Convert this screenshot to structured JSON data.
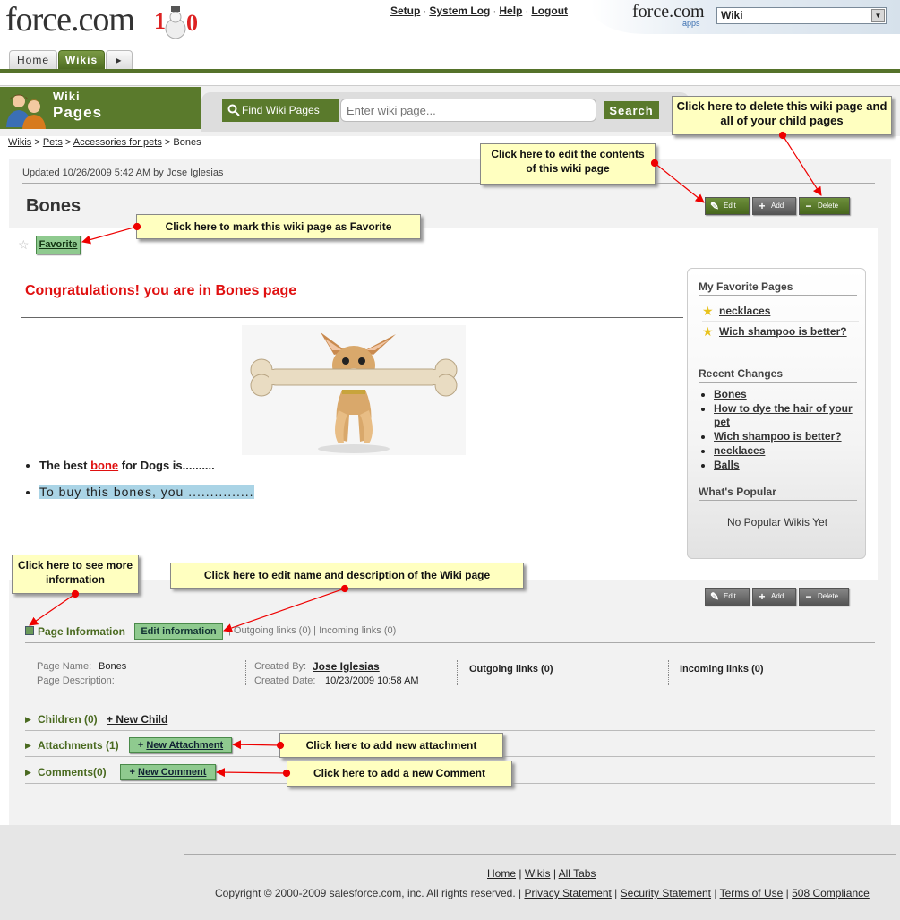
{
  "header": {
    "logo_text": "force.com",
    "top_links": [
      "Setup",
      "System Log",
      "Help",
      "Logout"
    ],
    "apps_logo": "force.com",
    "apps_sub": "apps",
    "app_selector_value": "Wiki"
  },
  "tabs": [
    "Home",
    "Wikis"
  ],
  "band": {
    "line1": "Wiki",
    "line2": "Pages",
    "find_label": "Find Wiki Pages",
    "search_placeholder": "Enter wiki page...",
    "search_button": "Search"
  },
  "breadcrumb": {
    "items": [
      "Wikis",
      "Pets",
      "Accessories for pets"
    ],
    "current": "Bones"
  },
  "page": {
    "updated": "Updated 10/26/2009 5:42 AM by Jose Iglesias",
    "title": "Bones",
    "buttons": {
      "edit": "Edit",
      "add": "Add",
      "delete": "Delete"
    },
    "favorite_button": "Favorite",
    "heading": "Congratulations! you are in Bones page",
    "bullet1_pre": "The best ",
    "bullet1_link": "bone",
    "bullet1_post": " for Dogs is..........",
    "bullet2": "To buy this bones, you ..............."
  },
  "sidebar": {
    "favorites_title": "My Favorite Pages",
    "favorites": [
      "necklaces",
      "Wich shampoo is better?"
    ],
    "recent_title": "Recent Changes",
    "recent": [
      "Bones",
      "How to dye the hair of your pet",
      "Wich shampoo is better?",
      "necklaces",
      "Balls"
    ],
    "popular_title": "What's Popular",
    "popular_empty": "No Popular Wikis Yet"
  },
  "page_info": {
    "label": "Page Information",
    "edit_button": "Edit information",
    "link_counts": "| Outgoing links (0) | Incoming links (0)",
    "page_name_label": "Page Name:",
    "page_name": "Bones",
    "page_desc_label": "Page Description:",
    "created_by_label": "Created By:",
    "created_by": "Jose Iglesias",
    "created_date_label": "Created Date:",
    "created_date": "10/23/2009 10:58 AM",
    "outgoing": "Outgoing links (0)",
    "incoming": "Incoming links (0)"
  },
  "sections": {
    "children": "Children (0)",
    "new_child": "+ New Child",
    "attachments": "Attachments (1)",
    "new_attachment": "New Attachment",
    "comments": "Comments(0)",
    "new_comment": "New Comment"
  },
  "footer": {
    "links": [
      "Home",
      "Wikis",
      "All Tabs"
    ],
    "copyright": "Copyright © 2000-2009 salesforce.com, inc. All rights reserved. |",
    "legal_links": [
      "Privacy Statement",
      "Security Statement",
      "Terms of Use",
      "508 Compliance"
    ]
  },
  "callouts": {
    "delete": "Click here to delete this wiki page and all of your child pages",
    "edit": "Click here to edit the contents of this wiki page",
    "favorite": "Click here to mark this wiki page as Favorite",
    "more_info": "Click here to see more information",
    "edit_name": "Click here to edit name and description of the Wiki page",
    "attachment": "Click here to add new attachment",
    "comment": "Click here to add a new Comment"
  },
  "colors": {
    "brand_green": "#5a7a2c",
    "heading_red": "#e01010",
    "callout_yellow": "#ffffc0",
    "favorite_button": "#8fca8f"
  }
}
